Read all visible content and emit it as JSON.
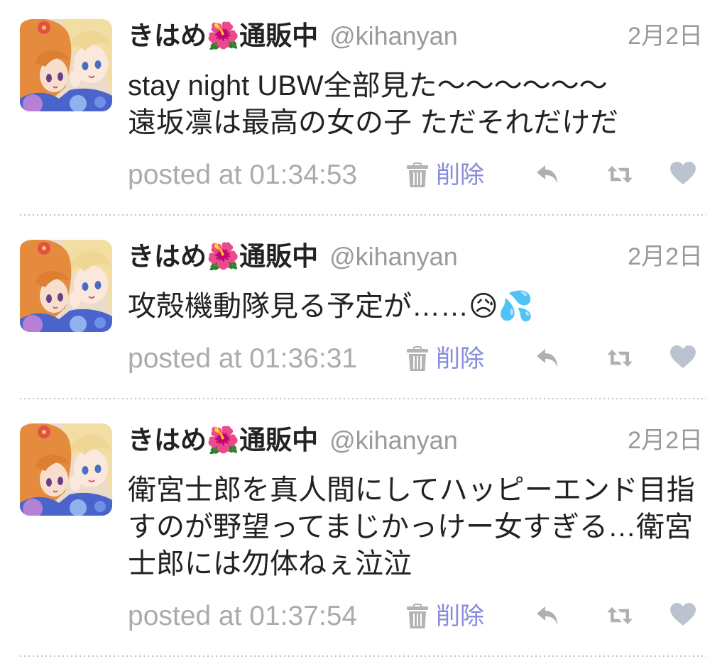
{
  "tweets": [
    {
      "user": {
        "name": "きはめ🌺通販中",
        "handle": "@kihanyan"
      },
      "date": "2月2日",
      "text": "stay night UBW全部見た〜〜〜〜〜〜\n遠坂凛は最高の女の子 ただそれだけだ",
      "posted_at": "posted at 01:34:53",
      "delete_label": "削除"
    },
    {
      "user": {
        "name": "きはめ🌺通販中",
        "handle": "@kihanyan"
      },
      "date": "2月2日",
      "text": "攻殻機動隊見る予定が……😥💦",
      "posted_at": "posted at 01:36:31",
      "delete_label": "削除"
    },
    {
      "user": {
        "name": "きはめ🌺通販中",
        "handle": "@kihanyan"
      },
      "date": "2月2日",
      "text": "衛宮士郎を真人間にしてハッピーエンド目指すのが野望ってまじかっけー女すぎる…衛宮士郎には勿体ねぇ泣泣",
      "posted_at": "posted at 01:37:54",
      "delete_label": "削除"
    }
  ],
  "icons": {
    "delete": "trash-icon",
    "reply": "reply-icon",
    "retweet": "retweet-icon",
    "favorite": "heart-icon"
  },
  "colors": {
    "text": "#222222",
    "meta": "#9a9a9a",
    "timestamp": "#ababab",
    "delete_accent": "#858bd8",
    "action_icon": "#b0b0b0",
    "heart": "#bac3cf",
    "separator": "#c2c2c2",
    "background": "#ffffff"
  }
}
